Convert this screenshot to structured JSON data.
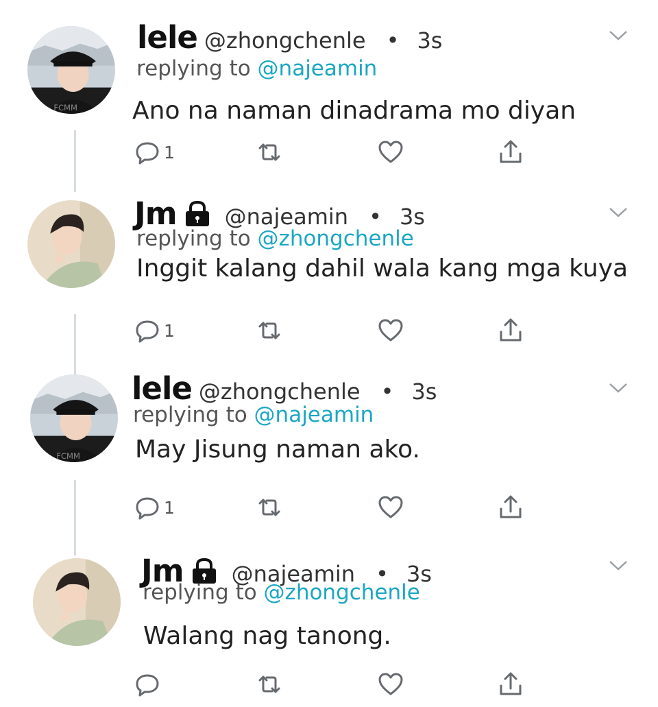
{
  "tweets": [
    {
      "name": "lele",
      "handle": "@zhongchenle",
      "dot": "•",
      "time": "3s",
      "reply_prefix": "replying to",
      "reply_to": "@najeamin",
      "text": "Ano na naman dinadrama mo diyan",
      "reply_count": "1",
      "locked": false,
      "avatar": "avatar-lele"
    },
    {
      "name": "Jm",
      "handle": "@najeamin",
      "dot": "•",
      "time": "3s",
      "reply_prefix": "replying to",
      "reply_to": "@zhongchenle",
      "text": "Inggit kalang dahil wala kang mga kuya",
      "reply_count": "1",
      "locked": true,
      "avatar": "avatar-jm"
    },
    {
      "name": "lele",
      "handle": "@zhongchenle",
      "dot": "•",
      "time": "3s",
      "reply_prefix": "replying to",
      "reply_to": "@najeamin",
      "text": "May Jisung naman ako.",
      "reply_count": "1",
      "locked": false,
      "avatar": "avatar-lele"
    },
    {
      "name": "Jm",
      "handle": "@najeamin",
      "dot": "•",
      "time": "3s",
      "reply_prefix": "replying to",
      "reply_to": "@zhongchenle",
      "text": "Walang nag tanong.",
      "reply_count": "",
      "locked": true,
      "avatar": "avatar-jm"
    }
  ],
  "icons": {
    "reply": "reply-icon",
    "retweet": "retweet-icon",
    "like": "heart-icon",
    "share": "share-icon",
    "menu": "chevron-down-icon",
    "lock": "lock-icon"
  },
  "colors": {
    "mention": "#1aa7c4",
    "icon": "#666a6e",
    "thread_line": "#d7dce0"
  }
}
